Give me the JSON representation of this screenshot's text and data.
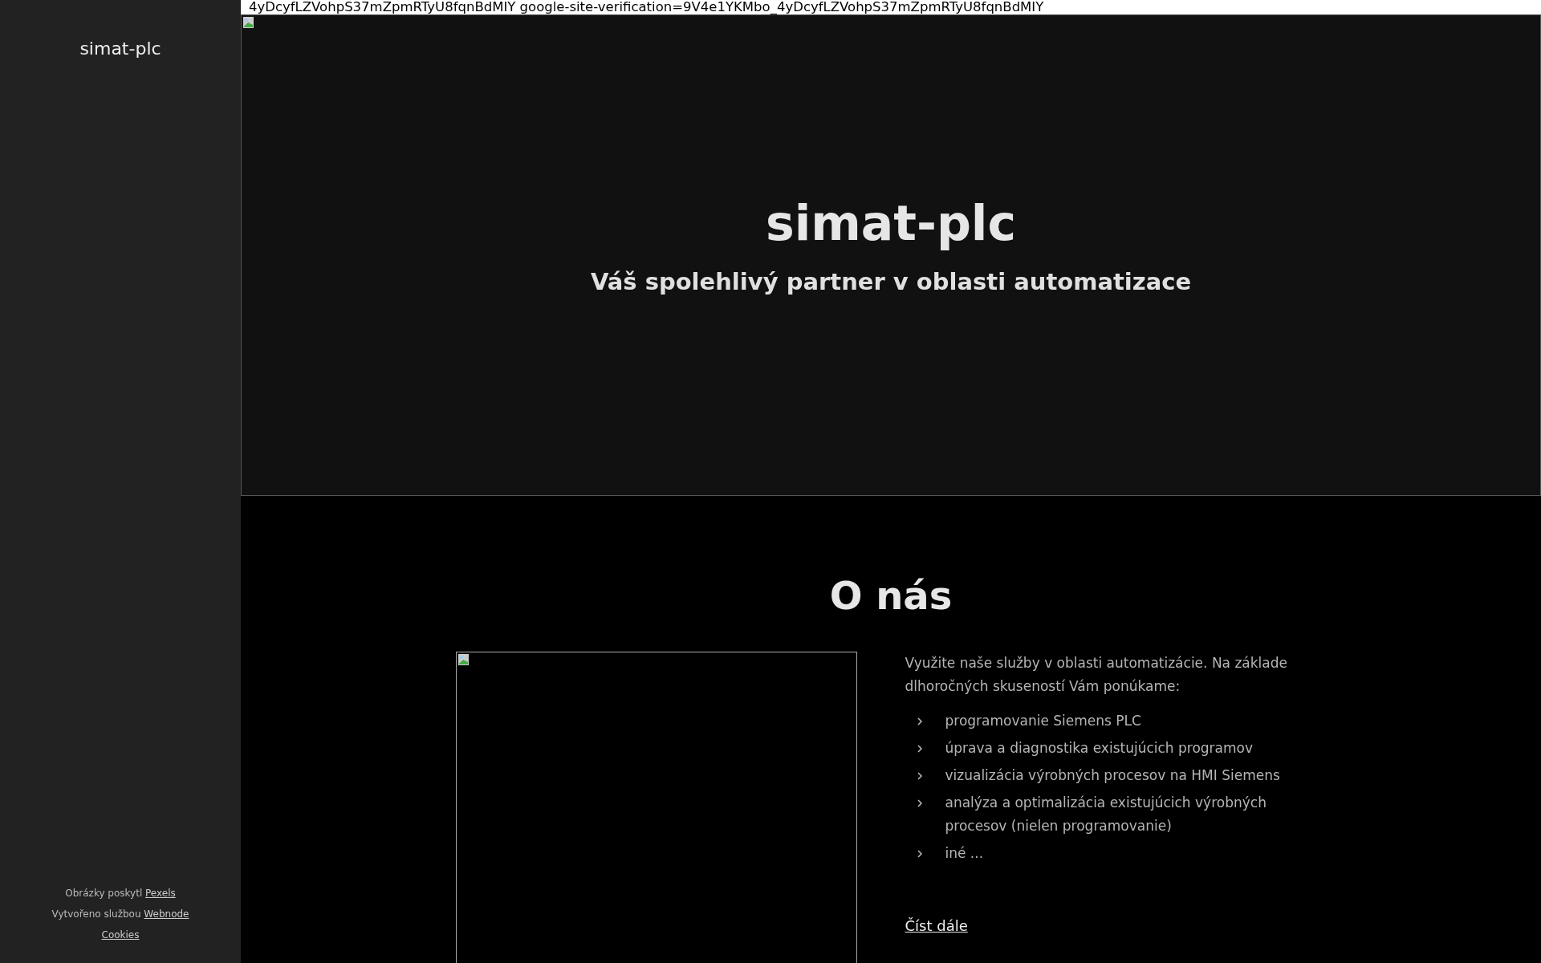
{
  "sidebar": {
    "title": "simat-plc",
    "footer": [
      {
        "text": "Obrázky poskytl",
        "link": "Pexels"
      },
      {
        "text": "Vytvořeno službou",
        "link": "Webnode"
      },
      {
        "link": "Cookies"
      }
    ]
  },
  "verification_text": "4yDcyfLZVohpS37mZpmRTyU8fqnBdMIY google-site-verification=9V4e1YKMbo_4yDcyfLZVohpS37mZpmRTyU8fqnBdMIY",
  "hero": {
    "title": "simat-plc",
    "subtitle": "Váš spolehlivý partner v oblasti automatizace"
  },
  "about": {
    "heading": "O nás",
    "intro": "Využite naše služby v oblasti automatizácie. Na základe dlhoročných skuseností Vám ponúkame:",
    "items": [
      "programovanie  Siemens PLC",
      "úprava a diagnostika existujúcich programov",
      "vizualizácia výrobných procesov na HMI Siemens",
      "analýza a optimalizácia existujúcich výrobných procesov (nielen programovanie)",
      "iné ..."
    ],
    "read_more": "Číst dále"
  }
}
